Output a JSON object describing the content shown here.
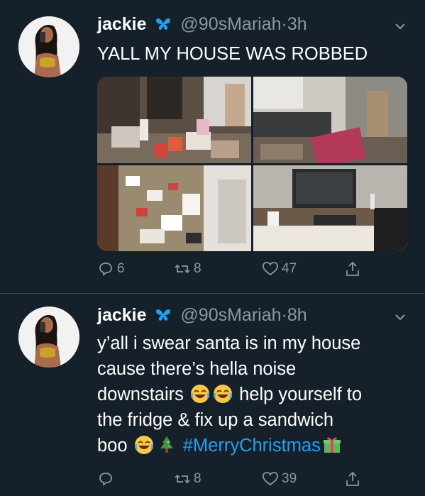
{
  "tweets": [
    {
      "name": "jackie",
      "badge": "butterfly",
      "handle": "@90sMariah",
      "dot": "·",
      "time": "3h",
      "text_lines": [
        "YALL MY HOUSE WAS ROBBED"
      ],
      "media_alts": [
        "ransacked bedroom",
        "overturned bed",
        "trashed bedroom floor",
        "kitchen counter"
      ],
      "replies": "6",
      "retweets": "8",
      "likes": "47"
    },
    {
      "name": "jackie",
      "badge": "butterfly",
      "handle": "@90sMariah",
      "dot": "·",
      "time": "8h",
      "text_lines": [
        "y’all i swear santa is in my house",
        "cause there’s hella noise",
        "downstairs",
        "help yourself to",
        "the fridge & fix up a sandwich",
        "boo"
      ],
      "hashtag": "#MerryChristmas",
      "emojis": [
        "laughing-emoji",
        "laughing-emoji",
        "laughing-emoji",
        "tree-emoji",
        "gift-emoji"
      ],
      "replies": "",
      "retweets": "8",
      "likes": "39"
    }
  ],
  "colors": {
    "background": "#15202b",
    "text": "#ffffff",
    "muted": "#8899a6",
    "accent": "#1da1f2",
    "divider": "#38444d"
  }
}
